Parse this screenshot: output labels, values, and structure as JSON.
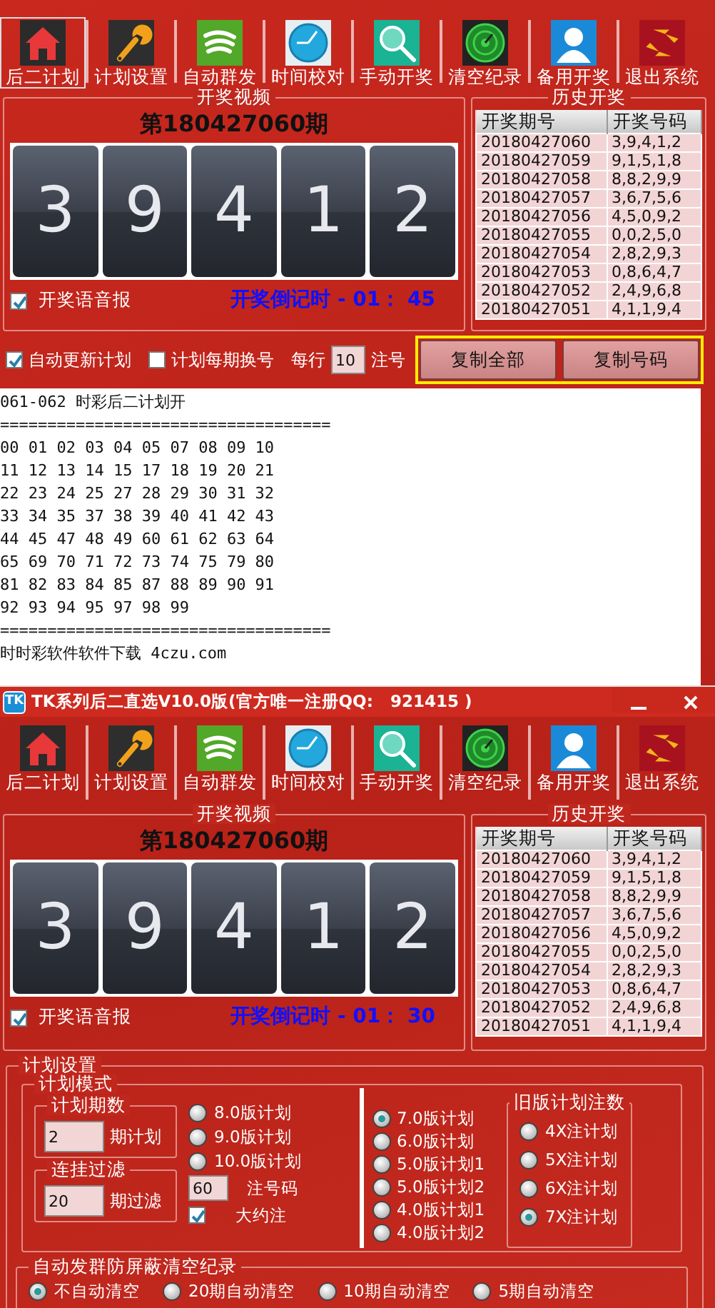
{
  "top_window": {
    "toolbar": [
      {
        "label": "后二计划",
        "selected": true
      },
      {
        "label": "计划设置",
        "selected": false
      },
      {
        "label": "自动群发",
        "selected": false
      },
      {
        "label": "时间校对",
        "selected": false
      },
      {
        "label": "手动开奖",
        "selected": false
      },
      {
        "label": "清空纪录",
        "selected": false
      },
      {
        "label": "备用开奖",
        "selected": false
      },
      {
        "label": "退出系统",
        "selected": false
      }
    ],
    "video": {
      "title": "开奖视频",
      "issue": "第180427060期",
      "digits": [
        "3",
        "9",
        "4",
        "1",
        "2"
      ],
      "voice": {
        "label": "开奖语音报",
        "checked": true
      },
      "countdown": "开奖倒记时 - 01： 45"
    },
    "history": {
      "title": "历史开奖",
      "columns": [
        "开奖期号",
        "开奖号码"
      ],
      "rows": [
        [
          "20180427060",
          "3,9,4,1,2"
        ],
        [
          "20180427059",
          "9,1,5,1,8"
        ],
        [
          "20180427058",
          "8,8,2,9,9"
        ],
        [
          "20180427057",
          "3,6,7,5,6"
        ],
        [
          "20180427056",
          "4,5,0,9,2"
        ],
        [
          "20180427055",
          "0,0,2,5,0"
        ],
        [
          "20180427054",
          "2,8,2,9,3"
        ],
        [
          "20180427053",
          "0,8,6,4,7"
        ],
        [
          "20180427052",
          "2,4,9,6,8"
        ],
        [
          "20180427051",
          "4,1,1,9,4"
        ]
      ]
    },
    "options": {
      "auto_update": {
        "label": "自动更新计划",
        "checked": true
      },
      "change_each": {
        "label": "计划每期换号",
        "checked": false
      },
      "per_row_label": "每行",
      "per_row_value": "10",
      "per_row_unit": "注号",
      "buttons": [
        "复制全部",
        "复制号码"
      ]
    },
    "plan_text": [
      "061-062 时彩后二计划开",
      "===================================",
      "00 01 02 03 04 05 07 08 09 10",
      "11 12 13 14 15 17 18 19 20 21",
      "22 23 24 25 27 28 29 30 31 32",
      "33 34 35 37 38 39 40 41 42 43",
      "44 45 47 48 49 60 61 62 63 64",
      "65 69 70 71 72 73 74 75 79 80",
      "81 82 83 84 85 87 88 89 90 91",
      "92 93 94 95 97 98 99",
      "===================================",
      "时时彩软件软件下载 4czu.com"
    ]
  },
  "bottom_window": {
    "badge": "TK",
    "title": "TK系列后二直选V10.0版(官方唯一注册QQ:   921415 )",
    "toolbar": [
      {
        "label": "后二计划",
        "selected": false
      },
      {
        "label": "计划设置",
        "selected": false
      },
      {
        "label": "自动群发",
        "selected": false
      },
      {
        "label": "时间校对",
        "selected": false
      },
      {
        "label": "手动开奖",
        "selected": false
      },
      {
        "label": "清空纪录",
        "selected": false
      },
      {
        "label": "备用开奖",
        "selected": false
      },
      {
        "label": "退出系统",
        "selected": false
      }
    ],
    "video": {
      "title": "开奖视频",
      "issue": "第180427060期",
      "digits": [
        "3",
        "9",
        "4",
        "1",
        "2"
      ],
      "voice": {
        "label": "开奖语音报",
        "checked": true
      },
      "countdown": "开奖倒记时 - 01： 30"
    },
    "history": {
      "title": "历史开奖",
      "columns": [
        "开奖期号",
        "开奖号码"
      ],
      "rows": [
        [
          "20180427060",
          "3,9,4,1,2"
        ],
        [
          "20180427059",
          "9,1,5,1,8"
        ],
        [
          "20180427058",
          "8,8,2,9,9"
        ],
        [
          "20180427057",
          "3,6,7,5,6"
        ],
        [
          "20180427056",
          "4,5,0,9,2"
        ],
        [
          "20180427055",
          "0,0,2,5,0"
        ],
        [
          "20180427054",
          "2,8,2,9,3"
        ],
        [
          "20180427053",
          "0,8,6,4,7"
        ],
        [
          "20180427052",
          "2,4,9,6,8"
        ],
        [
          "20180427051",
          "4,1,1,9,4"
        ]
      ]
    },
    "plan_settings": {
      "title": "计划设置",
      "mode": {
        "title": "计划模式",
        "periods": {
          "title": "计划期数",
          "value": "2",
          "unit": "期计划"
        },
        "filter": {
          "title": "连挂过滤",
          "value": "20",
          "unit": "期过滤"
        },
        "versions_a": [
          {
            "label": "8.0版计划",
            "selected": false
          },
          {
            "label": "9.0版计划",
            "selected": false
          },
          {
            "label": "10.0版计划",
            "selected": false
          }
        ],
        "count": {
          "value": "60",
          "unit": "注号码"
        },
        "approx": {
          "label": "大约注",
          "checked": true
        },
        "versions_b": [
          {
            "label": "7.0版计划",
            "selected": true
          },
          {
            "label": "6.0版计划",
            "selected": false
          },
          {
            "label": "5.0版计划1",
            "selected": false
          },
          {
            "label": "5.0版计划2",
            "selected": false
          },
          {
            "label": "4.0版计划1",
            "selected": false
          },
          {
            "label": "4.0版计划2",
            "selected": false
          }
        ],
        "old_counts": {
          "title": "旧版计划注数",
          "options": [
            {
              "label": "4X注计划",
              "selected": false
            },
            {
              "label": "5X注计划",
              "selected": false
            },
            {
              "label": "6X注计划",
              "selected": false
            },
            {
              "label": "7X注计划",
              "selected": true
            }
          ]
        }
      },
      "auto_clear": {
        "title": "自动发群防屏蔽清空纪录",
        "options": [
          {
            "label": "不自动清空",
            "selected": true
          },
          {
            "label": "20期自动清空",
            "selected": false
          },
          {
            "label": "10期自动清空",
            "selected": false
          },
          {
            "label": "5期自动清空",
            "selected": false
          }
        ]
      }
    }
  }
}
